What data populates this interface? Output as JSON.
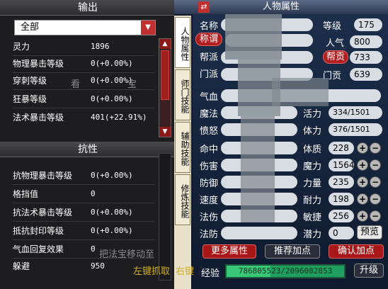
{
  "output_panel": {
    "title": "输出",
    "dropdown": {
      "value": "全部",
      "arrow_icon": "chevron-down-icon"
    },
    "stats": [
      {
        "label": "灵力",
        "value": "1896"
      },
      {
        "label": "物理暴击等级",
        "value": "0(+0.00%)"
      },
      {
        "label": "穿刺等级",
        "value": "0(+0.00%)"
      },
      {
        "label": "狂暴等级",
        "value": "0(+0.00%)"
      },
      {
        "label": "法术暴击等级",
        "value": "401(+22.91%)"
      }
    ]
  },
  "resist_panel": {
    "title": "抗性",
    "stats": [
      {
        "label": "抗物理暴击等级",
        "value": "0(+0.00%)"
      },
      {
        "label": "格挡值",
        "value": "0"
      },
      {
        "label": "抗法术暴击等级",
        "value": "0(+0.00%)"
      },
      {
        "label": "抵抗封印等级",
        "value": "0(+0.00%)"
      },
      {
        "label": "气血回复效果",
        "value": "0"
      },
      {
        "label": "躲避",
        "value": "950"
      }
    ]
  },
  "behind": {
    "hint": "把法宝移动至",
    "left_click": "左键抓取",
    "right_click": "右键",
    "misc": "看",
    "misc2": "宝"
  },
  "character_window": {
    "title": "人物属性",
    "tabs": [
      "人物属性",
      "师门技能",
      "辅助技能",
      "修炼技能"
    ],
    "labels": {
      "name": "名称",
      "title_btn": "称谓",
      "faction": "帮派",
      "sect": "门派",
      "hp": "气血",
      "mp": "魔法",
      "anger": "愤怒",
      "hit": "命中",
      "damage": "伤害",
      "defense": "防御",
      "speed": "速度",
      "spell_damage": "法伤",
      "spell_defense": "法防",
      "level": "等级",
      "popularity": "人气",
      "contribution_btn": "帮贡",
      "sect_contribution": "门贡",
      "vitality": "活力",
      "stamina": "体力",
      "constitution": "体质",
      "magic": "魔力",
      "strength": "力量",
      "endurance": "耐力",
      "agility": "敏捷",
      "potential": "潜力",
      "exp": "经验"
    },
    "values": {
      "level": "175",
      "popularity": "800",
      "contribution": "733",
      "sect_contribution": "639",
      "vitality": "334/1501",
      "stamina": "376/1501",
      "constitution": "228",
      "magic": "1564",
      "strength": "235",
      "endurance": "198",
      "agility": "256",
      "potential": "0",
      "exp": "786805523/2096082853",
      "exp_fraction": 0.375
    },
    "buttons": {
      "more_attributes": "更多属性",
      "recommend_points": "推荐加点",
      "confirm_points": "确认加点",
      "preview": "预览",
      "upgrade": "升级"
    },
    "colors": {
      "accent_red": "#a81818",
      "exp_green": "#20a060"
    }
  }
}
